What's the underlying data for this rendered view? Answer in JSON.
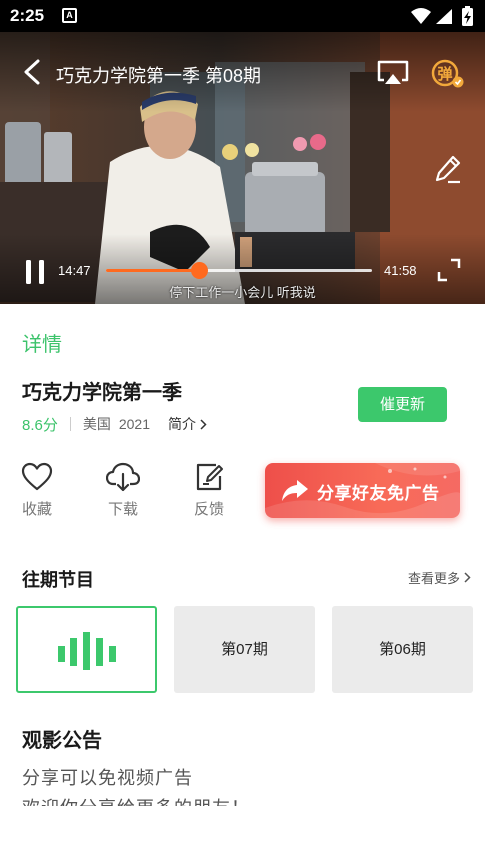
{
  "status_bar": {
    "time": "2:25",
    "notification_letter": "A"
  },
  "player": {
    "title": "巧克力学院第一季 第08期",
    "current_time": "14:47",
    "total_time": "41:58",
    "progress_fraction": 0.35,
    "subtitle": "停下工作一小会儿 听我说",
    "danmu_label": "弹",
    "accent_color": "#ff6a1f"
  },
  "details": {
    "heading": "详情",
    "show_title": "巧克力学院第一季",
    "rating": "8.6分",
    "region": "美国",
    "year": "2021",
    "intro_label": "简介",
    "update_button": "催更新"
  },
  "actions": {
    "favorite": "收藏",
    "download": "下载",
    "feedback": "反馈",
    "share_banner": "分享好友免广告"
  },
  "episodes": {
    "title": "往期节目",
    "more_label": "查看更多",
    "items": [
      {
        "label": "",
        "playing": true
      },
      {
        "label": "第07期"
      },
      {
        "label": "第06期"
      }
    ]
  },
  "notice": {
    "title": "观影公告",
    "lines": [
      "分享可以免视频广告",
      "欢迎你分享给更多的朋友！"
    ]
  },
  "colors": {
    "brand_green": "#3cc86c",
    "share_red": "#f0574e"
  }
}
